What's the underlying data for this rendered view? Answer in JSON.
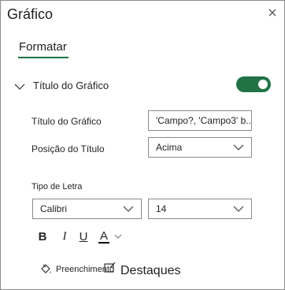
{
  "pane": {
    "title": "Gráfico"
  },
  "tabs": {
    "active": "Formatar"
  },
  "section": {
    "label": "Título do Gráfico",
    "enabled": true
  },
  "title_field": {
    "label": "Título do Gráfico",
    "value": "'Campo?, 'Campo3' b..."
  },
  "position_field": {
    "label": "Posição do Título",
    "value": "Acima"
  },
  "font": {
    "label": "Tipo de Letra",
    "family": "Calibri",
    "size": "14",
    "bold": "B",
    "italic": "I",
    "underline": "U",
    "color": "A"
  },
  "bottom_tabs": {
    "fill": "Preenchimento",
    "highlights": "Destaques"
  },
  "colors": {
    "accent": "#217346",
    "font_color_bar": "#000000"
  },
  "icons": [
    "close-icon",
    "chevron-down-icon",
    "paint-bucket-icon",
    "border-icon"
  ]
}
